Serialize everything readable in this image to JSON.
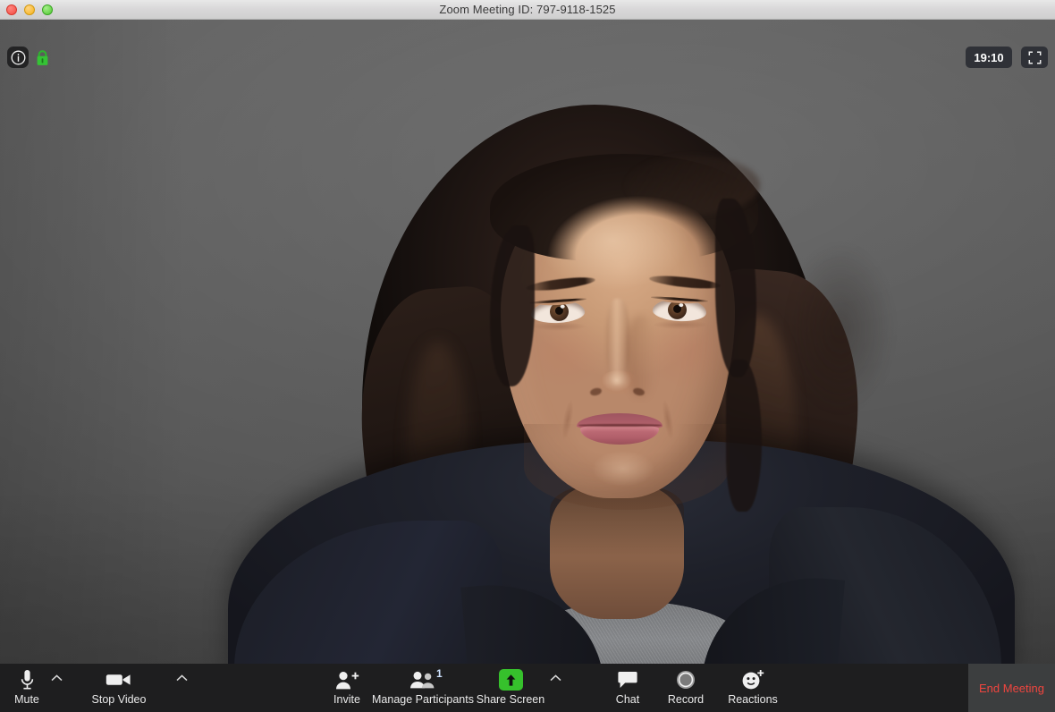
{
  "window": {
    "title": "Zoom Meeting ID: 797-9118-1525",
    "traffic_lights": [
      "close",
      "minimize",
      "maximize"
    ]
  },
  "overlay": {
    "info_icon": "info-circle-icon",
    "lock_icon": "green-padlock-icon",
    "timer": "19:10",
    "fullscreen_icon": "enter-fullscreen-icon"
  },
  "video": {
    "participant_view": "active-speaker-video",
    "background_color": "#5b5b5b",
    "description": "Single participant on camera against a plain gray wall"
  },
  "toolbar": {
    "background_color": "#1e1e1f",
    "left": [
      {
        "label": "Mute",
        "icon": "microphone-icon",
        "caret": "chevron-up-icon"
      },
      {
        "label": "Stop Video",
        "icon": "video-camera-icon",
        "caret": "chevron-up-icon"
      }
    ],
    "middle": [
      {
        "label": "Invite",
        "icon": "person-add-icon"
      },
      {
        "label": "Manage Participants",
        "icon": "participants-icon",
        "badge": "1",
        "badge_color": "#cfe3ff"
      },
      {
        "label": "Share Screen",
        "icon": "share-screen-up-arrow-icon",
        "accent_color": "#36c12c",
        "caret": "chevron-up-icon"
      }
    ],
    "right": [
      {
        "label": "Chat",
        "icon": "chat-bubble-icon"
      },
      {
        "label": "Record",
        "icon": "record-circle-icon"
      },
      {
        "label": "Reactions",
        "icon": "smiley-plus-icon"
      }
    ],
    "end": {
      "label": "End Meeting",
      "color": "#f0453f",
      "panel_color": "#3c3e3f"
    }
  }
}
